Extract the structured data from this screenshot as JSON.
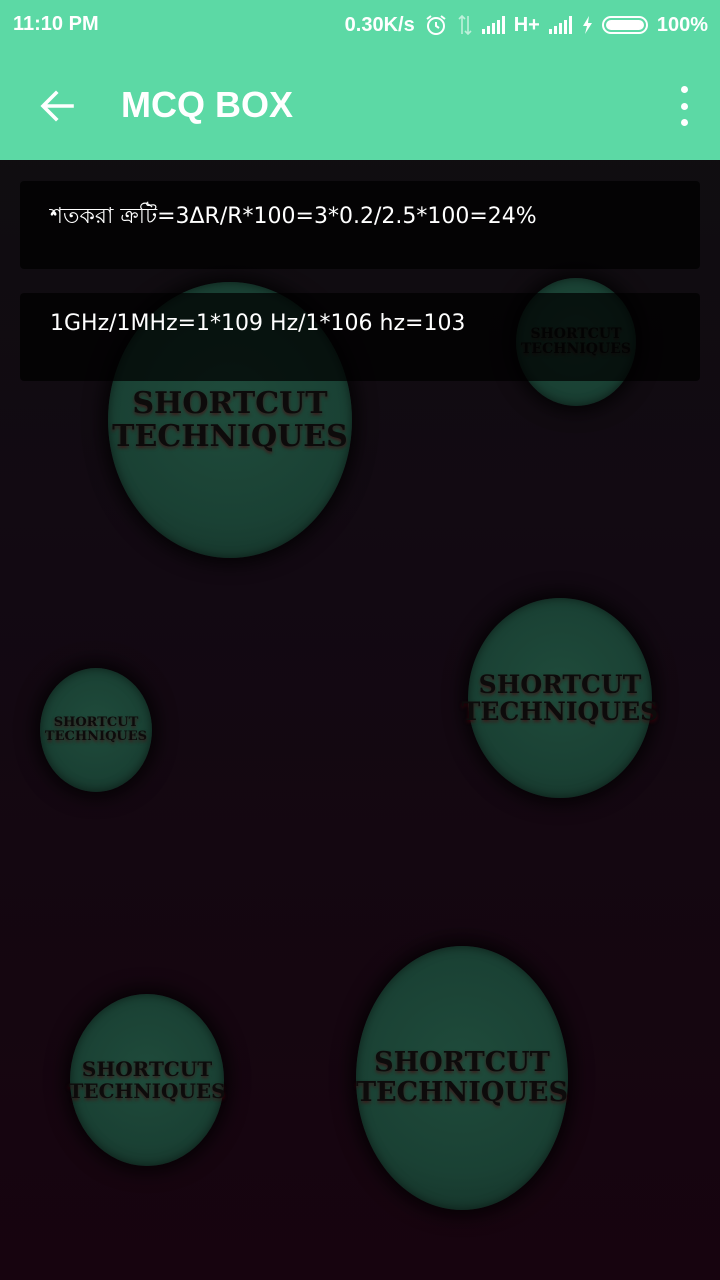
{
  "status_bar": {
    "time": "11:10 PM",
    "speed": "0.30K/s",
    "network": "H+",
    "battery_text": "100%",
    "battery_level": 1.0
  },
  "app_bar": {
    "title": "MCQ BOX",
    "back_icon": "arrow-left-icon",
    "menu_icon": "overflow-menu-icon"
  },
  "answers": [
    {
      "text": "শতকরা ক্রটি=3ΔR/R*100=3*0.2/2.5*100=24%"
    },
    {
      "text": "1GHz/1MHz=1*109 Hz/1*106 hz=103"
    }
  ],
  "background": {
    "bubble_line1": "SHORTCUT",
    "bubble_line2": "TECHNIQUES"
  },
  "colors": {
    "accent": "#5cd9a5",
    "card": "#000000",
    "bubble": "#1f4b3b"
  }
}
